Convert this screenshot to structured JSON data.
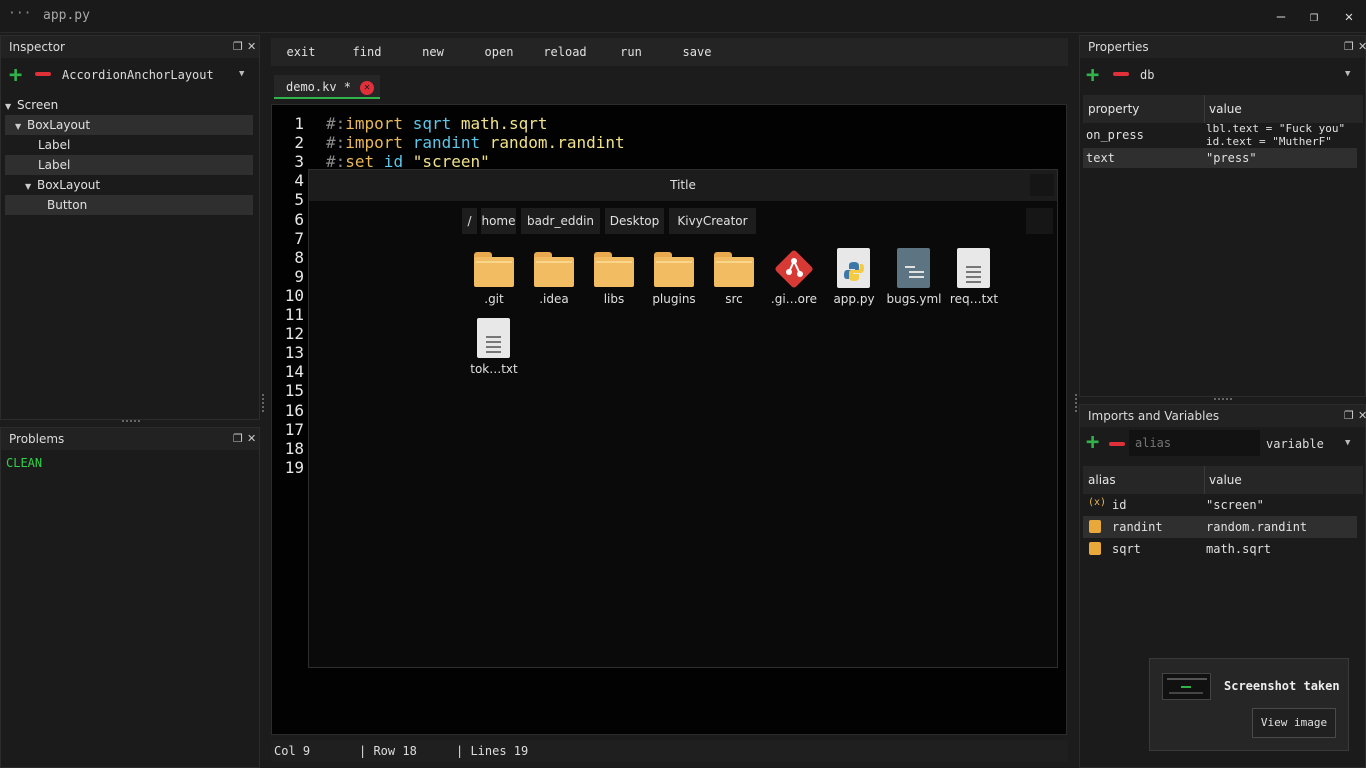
{
  "window": {
    "title": "app.py",
    "menu_dots": "···",
    "min": "—",
    "max": "❐",
    "close": "✕"
  },
  "inspector": {
    "title": "Inspector",
    "layout_select": "AccordionAnchorLayout",
    "tree": [
      {
        "label": "Screen",
        "expanded": true
      },
      {
        "label": "BoxLayout",
        "expanded": true
      },
      {
        "label": "Label"
      },
      {
        "label": "Label"
      },
      {
        "label": "BoxLayout",
        "expanded": true
      },
      {
        "label": "Button"
      }
    ]
  },
  "problems": {
    "title": "Problems",
    "status": "CLEAN"
  },
  "toolbar": {
    "items": [
      "exit",
      "find",
      "new",
      "open",
      "reload",
      "run",
      "save"
    ]
  },
  "tab": {
    "label": "demo.kv *",
    "close": "✕"
  },
  "editor": {
    "line_numbers": [
      "1",
      "2",
      "3",
      "4",
      "5",
      "6",
      "7",
      "8",
      "9",
      "10",
      "11",
      "12",
      "13",
      "14",
      "15",
      "16",
      "17",
      "18",
      "19"
    ],
    "lines": [
      [
        {
          "t": "#:",
          "c": "cm"
        },
        {
          "t": "import",
          "c": "kw"
        },
        {
          "t": " sqrt",
          "c": "id"
        },
        {
          "t": " math.sqrt",
          "c": "fn"
        }
      ],
      [
        {
          "t": "#:",
          "c": "cm"
        },
        {
          "t": "import",
          "c": "kw"
        },
        {
          "t": " randint",
          "c": "id"
        },
        {
          "t": " random.randint",
          "c": "fn"
        }
      ],
      [
        {
          "t": "#:",
          "c": "cm"
        },
        {
          "t": "set",
          "c": "kw"
        },
        {
          "t": " id",
          "c": "id"
        },
        {
          "t": " \"screen\"",
          "c": "st"
        }
      ]
    ]
  },
  "file_dialog": {
    "title": "Title",
    "breadcrumb": [
      "/",
      "home",
      "badr_eddin",
      "Desktop",
      "KivyCreator"
    ],
    "files": [
      {
        "name": ".git",
        "icon": "folder-icon"
      },
      {
        "name": ".idea",
        "icon": "folder-icon"
      },
      {
        "name": "libs",
        "icon": "folder-icon"
      },
      {
        "name": "plugins",
        "icon": "folder-icon"
      },
      {
        "name": "src",
        "icon": "folder-icon"
      },
      {
        "name": ".gi…ore",
        "icon": "git-icon"
      },
      {
        "name": "app.py",
        "icon": "python-icon"
      },
      {
        "name": "bugs.yml",
        "icon": "yaml-icon"
      },
      {
        "name": "req…txt",
        "icon": "text-file-icon"
      },
      {
        "name": "tok…txt",
        "icon": "text-file-icon"
      }
    ]
  },
  "statusbar": {
    "col": "Col 9",
    "row": "| Row 18",
    "lines": "| Lines 19"
  },
  "properties": {
    "title": "Properties",
    "select": "db",
    "headers": [
      "property",
      "value"
    ],
    "rows": [
      {
        "property": "on_press",
        "value1": "lbl.text = \"Fuck you\"",
        "value2": "id.text = \"MutherF\""
      },
      {
        "property": "text",
        "value1": "\"press\""
      }
    ]
  },
  "imports": {
    "title": "Imports and Variables",
    "alias_placeholder": "alias",
    "type_select": "variable",
    "headers": [
      "alias",
      "value"
    ],
    "rows": [
      {
        "icon": "variable-icon",
        "alias": "id",
        "value": "\"screen\""
      },
      {
        "icon": "module-icon",
        "alias": "randint",
        "value": "random.randint"
      },
      {
        "icon": "module-icon",
        "alias": "sqrt",
        "value": "math.sqrt"
      }
    ]
  },
  "toast": {
    "title": "Screenshot taken",
    "button": "View image"
  },
  "colors": {
    "accent_green": "#2fb34a",
    "accent_red": "#e0303a",
    "background": "#1c1c1c"
  }
}
